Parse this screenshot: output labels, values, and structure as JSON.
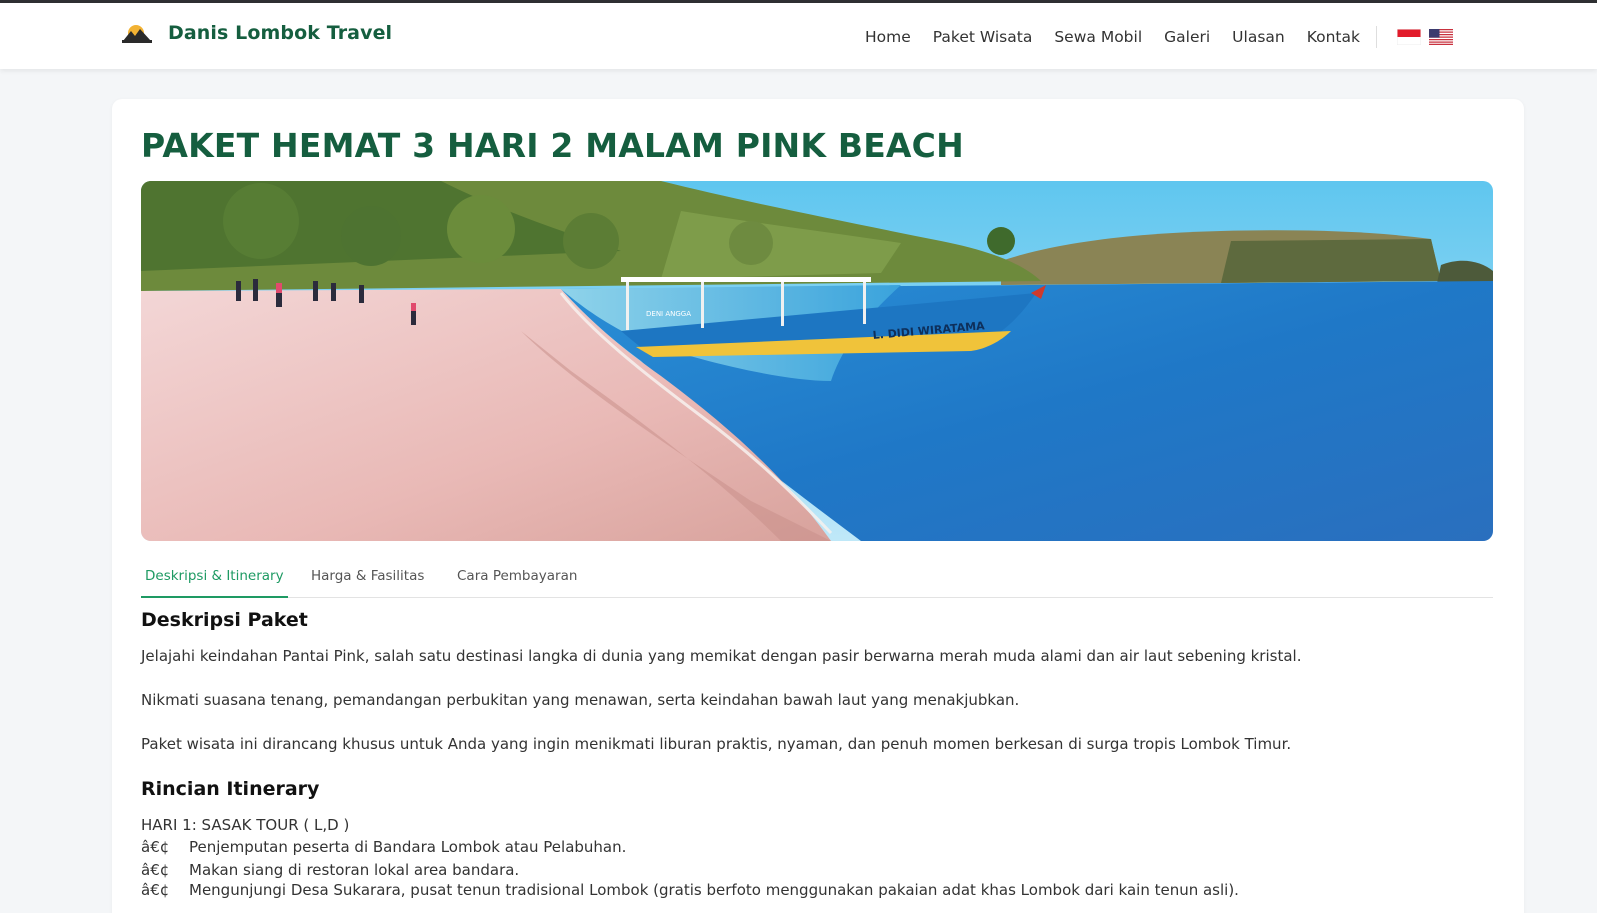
{
  "brand": {
    "name": "Danis Lombok Travel",
    "logo_icon": "sunrise-icon"
  },
  "nav": {
    "items": [
      {
        "label": "Home"
      },
      {
        "label": "Paket Wisata"
      },
      {
        "label": "Sewa Mobil"
      },
      {
        "label": "Galeri"
      },
      {
        "label": "Ulasan"
      },
      {
        "label": "Kontak"
      }
    ],
    "languages": [
      {
        "icon": "flag-indonesia-icon"
      },
      {
        "icon": "flag-usa-icon"
      }
    ]
  },
  "page": {
    "title": "PAKET HEMAT 3 HARI 2 MALAM PINK BEACH"
  },
  "hero": {
    "boat_name": "L. DIDI WIRATAMA",
    "boat_name_small": "DENI ANGGA"
  },
  "tabs": [
    {
      "label": "Deskripsi & Itinerary",
      "active": true
    },
    {
      "label": "Harga & Fasilitas",
      "active": false
    },
    {
      "label": "Cara Pembayaran",
      "active": false
    }
  ],
  "description": {
    "title": "Deskripsi Paket",
    "paragraphs": [
      "Jelajahi keindahan Pantai Pink, salah satu destinasi langka di dunia yang memikat dengan pasir berwarna merah muda alami dan air laut sebening kristal.",
      "Nikmati suasana tenang, pemandangan perbukitan yang menawan, serta keindahan bawah laut yang menakjubkan.",
      "Paket wisata ini dirancang khusus untuk Anda yang ingin menikmati liburan praktis, nyaman, dan penuh momen berkesan di surga tropis Lombok Timur."
    ]
  },
  "itinerary": {
    "title": "Rincian Itinerary",
    "day1": "HARI 1: SASAK TOUR ( L,D )",
    "bullet": "â€¢",
    "items": [
      "Penjemputan peserta di Bandara Lombok atau Pelabuhan.",
      "Makan siang di restoran lokal area bandara.",
      "Mengunjungi Desa Sukarara, pusat tenun tradisional Lombok (gratis berfoto menggunakan pakaian adat khas Lombok dari kain tenun asli)."
    ]
  },
  "colors": {
    "brand": "#155e3f",
    "accent": "#1e9a63"
  }
}
